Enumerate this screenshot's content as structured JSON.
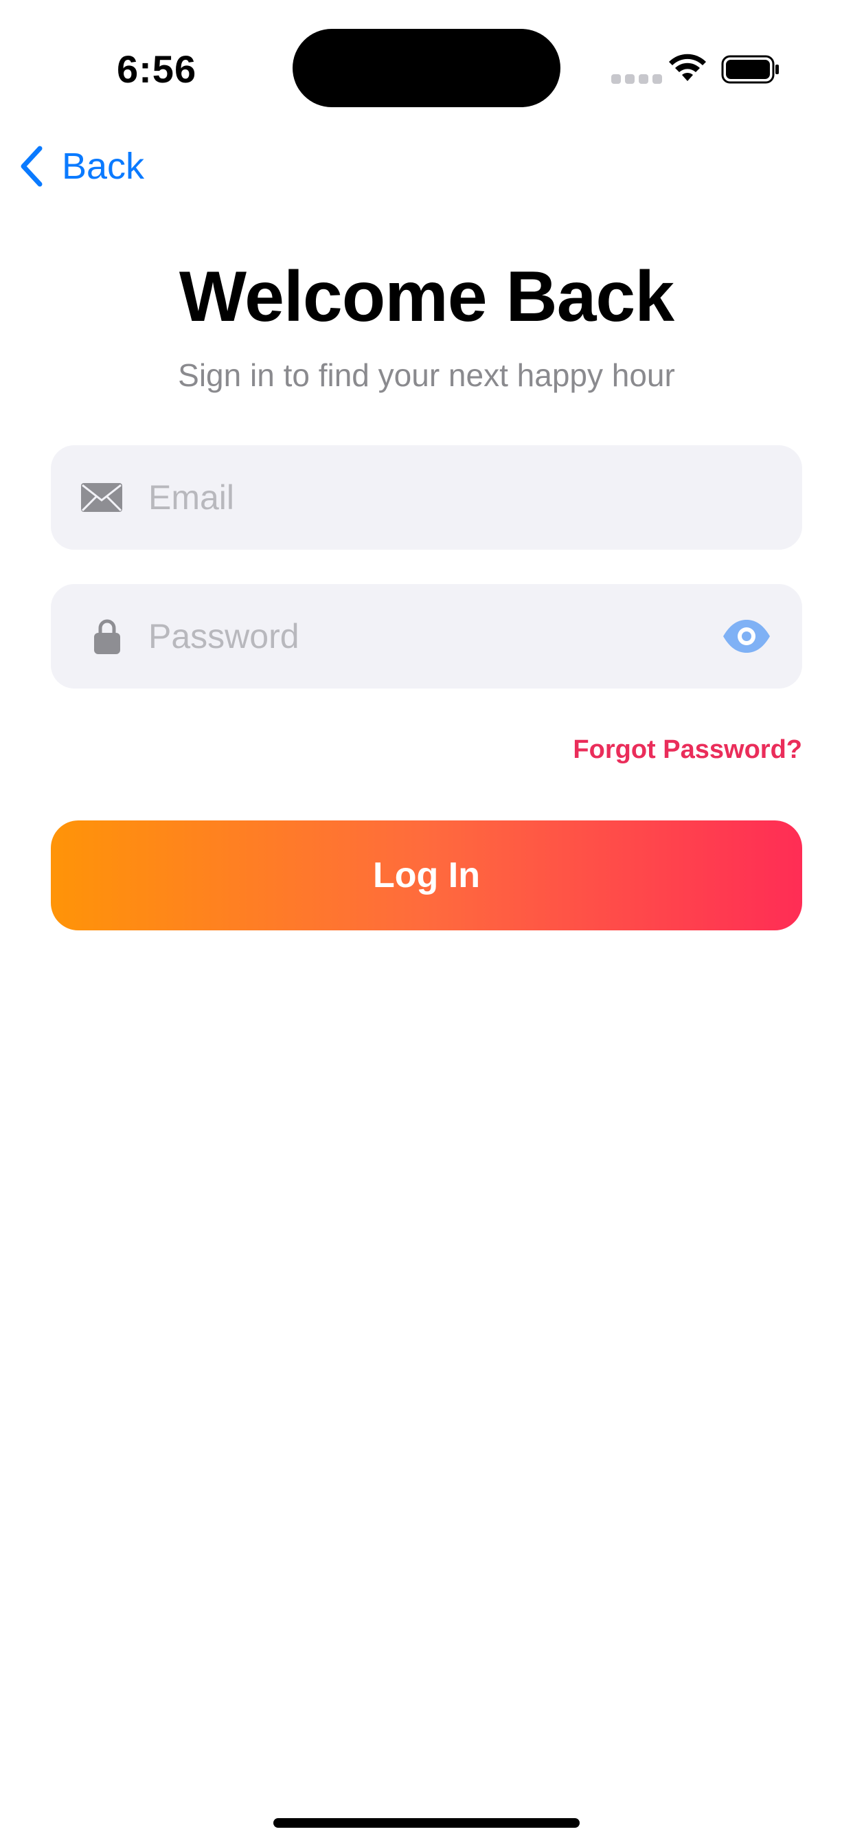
{
  "status_bar": {
    "time": "6:56"
  },
  "navigation": {
    "back_label": "Back"
  },
  "header": {
    "title": "Welcome Back",
    "subtitle": "Sign in to find your next happy hour"
  },
  "form": {
    "email": {
      "value": "",
      "placeholder": "Email",
      "icon": "envelope-icon"
    },
    "password": {
      "value": "",
      "placeholder": "Password",
      "icon": "lock-icon",
      "toggle_icon": "eye-icon"
    },
    "forgot_password_label": "Forgot Password?",
    "login_label": "Log In"
  },
  "colors": {
    "accent_blue": "#0a7aff",
    "link_pink": "#ea2d5a",
    "gradient_start": "#ff9408",
    "gradient_end": "#ff2d55",
    "field_background": "#f2f2f7"
  }
}
